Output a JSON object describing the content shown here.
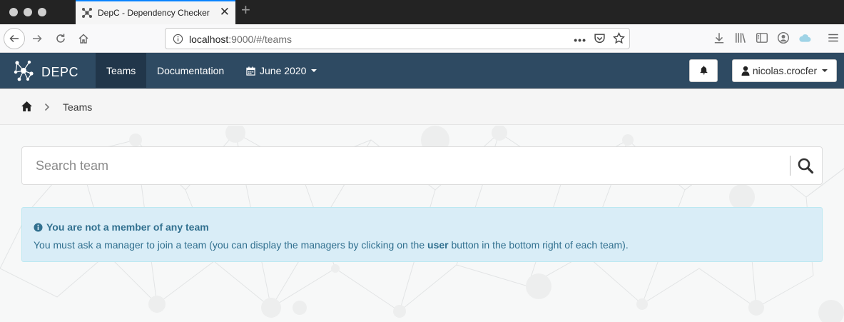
{
  "browser": {
    "tab_title": "DepC - Dependency Checker",
    "url_host": "localhost",
    "url_path": ":9000/#/teams"
  },
  "navbar": {
    "brand": "DEPC",
    "items": [
      {
        "label": "Teams",
        "active": true
      },
      {
        "label": "Documentation",
        "active": false
      }
    ],
    "date_label": "June 2020",
    "user": "nicolas.crocfer"
  },
  "breadcrumb": {
    "current": "Teams"
  },
  "search": {
    "placeholder": "Search team"
  },
  "alert": {
    "title": "You are not a member of any team",
    "body_before": "You must ask a manager to join a team (you can display the managers by clicking on the ",
    "body_bold": "user",
    "body_after": " button in the bottom right of each team)."
  },
  "colors": {
    "navbar": "#2e4a62",
    "navbar_active": "#21364a",
    "alert_bg": "#d9edf7",
    "alert_text": "#31708f",
    "firefox_blue": "#0a84ff"
  },
  "icons": [
    "close-icon",
    "plus-icon",
    "back-arrow-icon",
    "forward-arrow-icon",
    "reload-icon",
    "home-icon",
    "info-icon",
    "more-icon",
    "pocket-icon",
    "star-icon",
    "download-icon",
    "library-icon",
    "sidebar-icon",
    "account-icon",
    "cloud-icon",
    "menu-icon",
    "depc-logo-icon",
    "calendar-icon",
    "bell-icon",
    "user-icon",
    "chevron-right-icon",
    "search-icon",
    "info-circle-icon"
  ]
}
